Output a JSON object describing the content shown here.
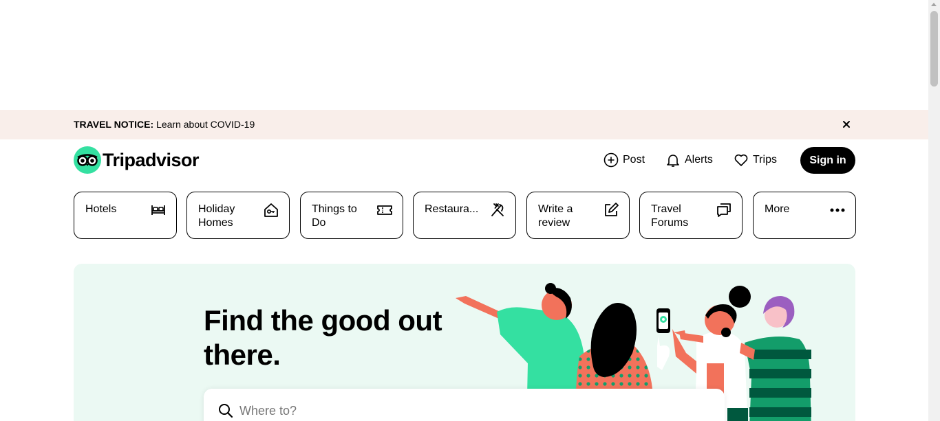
{
  "notice": {
    "title": "TRAVEL NOTICE:",
    "link": "Learn about COVID-19"
  },
  "brand": {
    "name": "Tripadvisor",
    "accent": "#34e0a1"
  },
  "header": {
    "post_label": "Post",
    "alerts_label": "Alerts",
    "trips_label": "Trips",
    "signin_label": "Sign in"
  },
  "categories": [
    {
      "label": "Hotels",
      "icon": "bed-icon"
    },
    {
      "label": "Holiday Homes",
      "icon": "house-key-icon"
    },
    {
      "label": "Things to Do",
      "icon": "ticket-icon"
    },
    {
      "label": "Restaura...",
      "icon": "fork-knife-icon"
    },
    {
      "label": "Write a review",
      "icon": "pencil-square-icon"
    },
    {
      "label": "Travel Forums",
      "icon": "chat-bubbles-icon"
    },
    {
      "label": "More",
      "icon": "ellipsis-icon"
    }
  ],
  "hero": {
    "title": "Find the good out there.",
    "search_placeholder": "Where to?"
  },
  "colors": {
    "notice_bg": "#f9eeea",
    "hero_bg": "#ebf9f3",
    "coral": "#f2725b",
    "green": "#34e0a1",
    "dark_green": "#00583e",
    "purple": "#9b5fc0"
  }
}
